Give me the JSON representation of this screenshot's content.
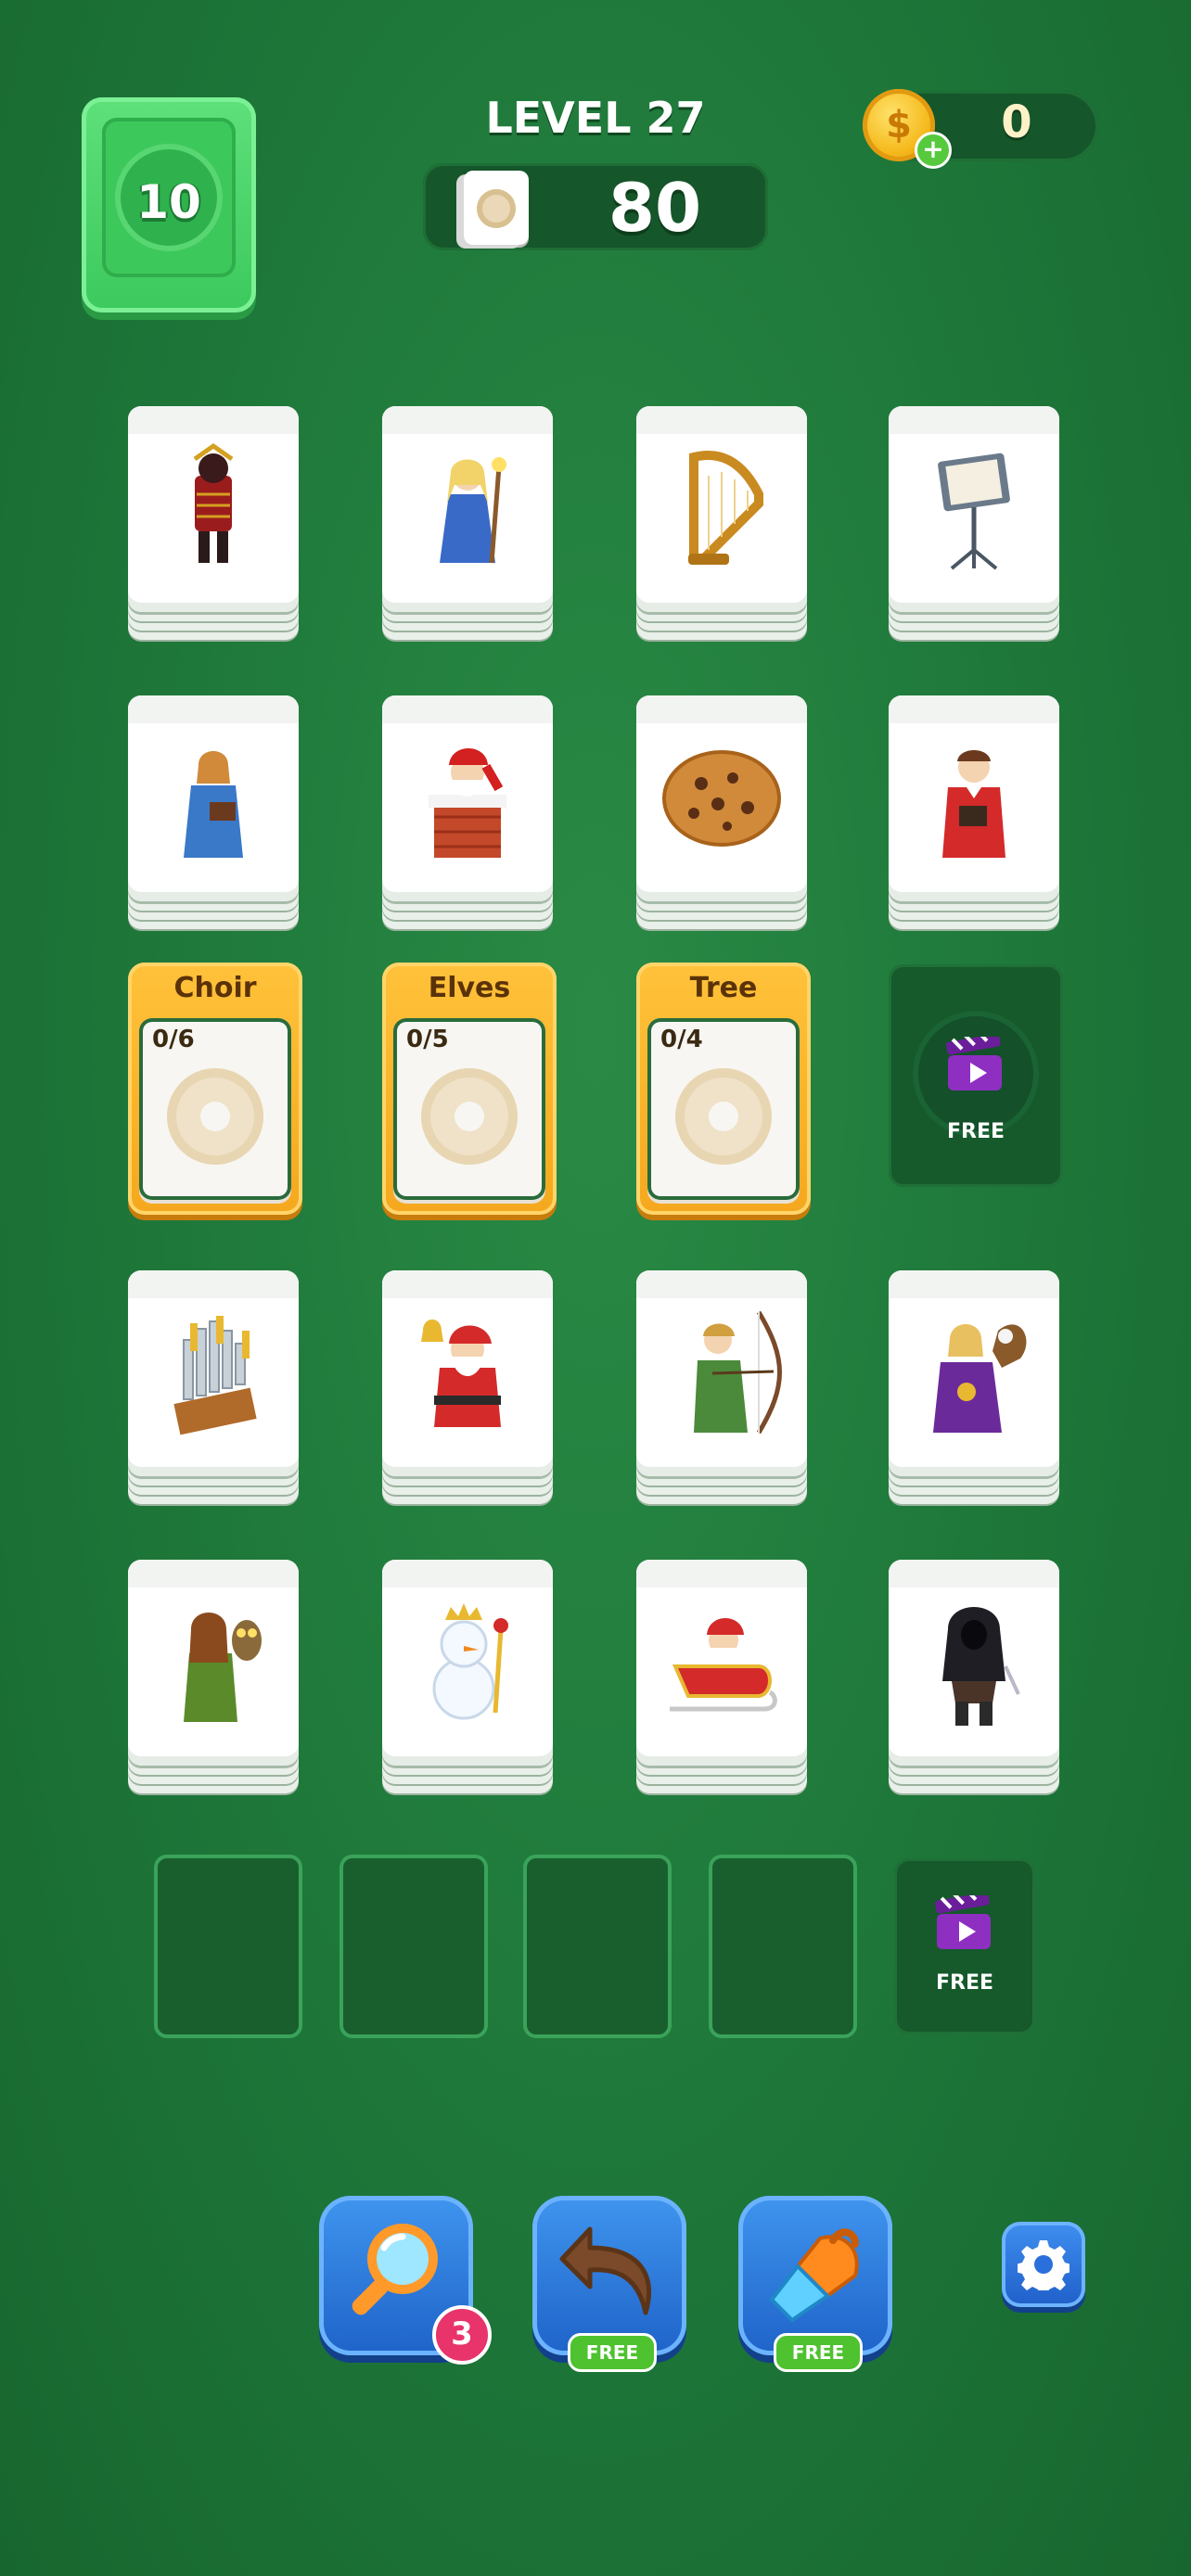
{
  "header": {
    "moves_left": "10",
    "level_label": "LEVEL 27",
    "score": "80",
    "coins": "0"
  },
  "tiles": [
    {
      "id": "samurai",
      "icon": "samurai-icon"
    },
    {
      "id": "elf-wizard",
      "icon": "elf-mage-icon"
    },
    {
      "id": "harp",
      "icon": "harp-icon"
    },
    {
      "id": "music-stand",
      "icon": "music-stand-icon"
    },
    {
      "id": "choir-woman",
      "icon": "choir-singer-woman-icon"
    },
    {
      "id": "santa-chimney",
      "icon": "santa-chimney-icon"
    },
    {
      "id": "cookie",
      "icon": "cookie-icon"
    },
    {
      "id": "choir-man",
      "icon": "choir-singer-man-icon"
    },
    {
      "id": "organ-pipes",
      "icon": "pipe-organ-icon"
    },
    {
      "id": "santa-bell",
      "icon": "santa-bell-icon"
    },
    {
      "id": "elf-archer",
      "icon": "elf-archer-icon"
    },
    {
      "id": "elf-falconer",
      "icon": "elf-falconer-icon"
    },
    {
      "id": "forest-elf",
      "icon": "forest-elf-owl-icon"
    },
    {
      "id": "snowman",
      "icon": "snowman-king-icon"
    },
    {
      "id": "santa-sleigh",
      "icon": "santa-sleigh-icon"
    },
    {
      "id": "hooded-rogue",
      "icon": "hooded-rogue-icon"
    }
  ],
  "categories": [
    {
      "title": "Choir",
      "progress": "0/6"
    },
    {
      "title": "Elves",
      "progress": "0/5"
    },
    {
      "title": "Tree",
      "progress": "0/4"
    }
  ],
  "free_label": "FREE",
  "tools": {
    "magnifier_count": "3",
    "undo_label": "FREE",
    "vacuum_label": "FREE"
  },
  "colors": {
    "background": "#1f7a3b",
    "category_card": "#f5a81e",
    "tool_button": "#2a77dc",
    "moves_box": "#3cc95d"
  }
}
